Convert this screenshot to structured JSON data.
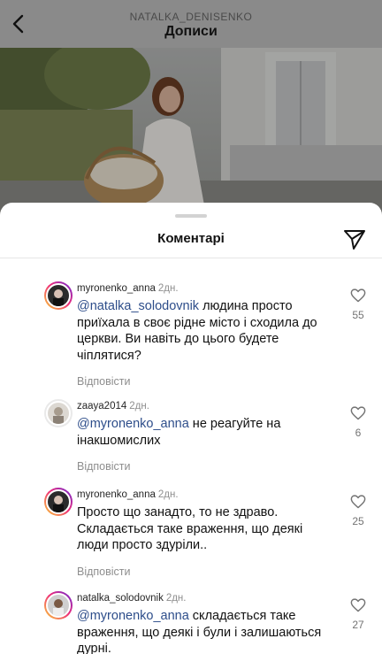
{
  "header": {
    "username": "NATALKA_DENISENKO",
    "title": "Дописи"
  },
  "sheet": {
    "title": "Коментарі"
  },
  "comments": [
    {
      "username": "myronenko_anna",
      "time": "2дн.",
      "mention": "@natalka_solodovnik",
      "text": " людина просто приїхала в своє рідне місто і сходила до церкви. Ви навіть до цього будете чіплятися?",
      "reply": "Відповісти",
      "likes": "55"
    },
    {
      "username": "zaaya2014",
      "time": "2дн.",
      "mention": "@myronenko_anna",
      "text": " не реагуйте на інакшомислих",
      "reply": "Відповісти",
      "likes": "6"
    },
    {
      "username": "myronenko_anna",
      "time": "2дн.",
      "mention": "",
      "text": "Просто що занадто, то не здраво. Складається таке враження, що деякі люди просто здуріли..",
      "reply": "Відповісти",
      "likes": "25"
    },
    {
      "username": "natalka_solodovnik",
      "time": "2дн.",
      "mention": "@myronenko_anna",
      "text": " складається таке враження, що деякі і були і залишаються дурні.",
      "reply": "",
      "likes": "27"
    }
  ],
  "colors": {
    "mention": "#2d4d8a",
    "secondary_text": "#8e8e8e",
    "story_ring": "#ee2a7b"
  }
}
